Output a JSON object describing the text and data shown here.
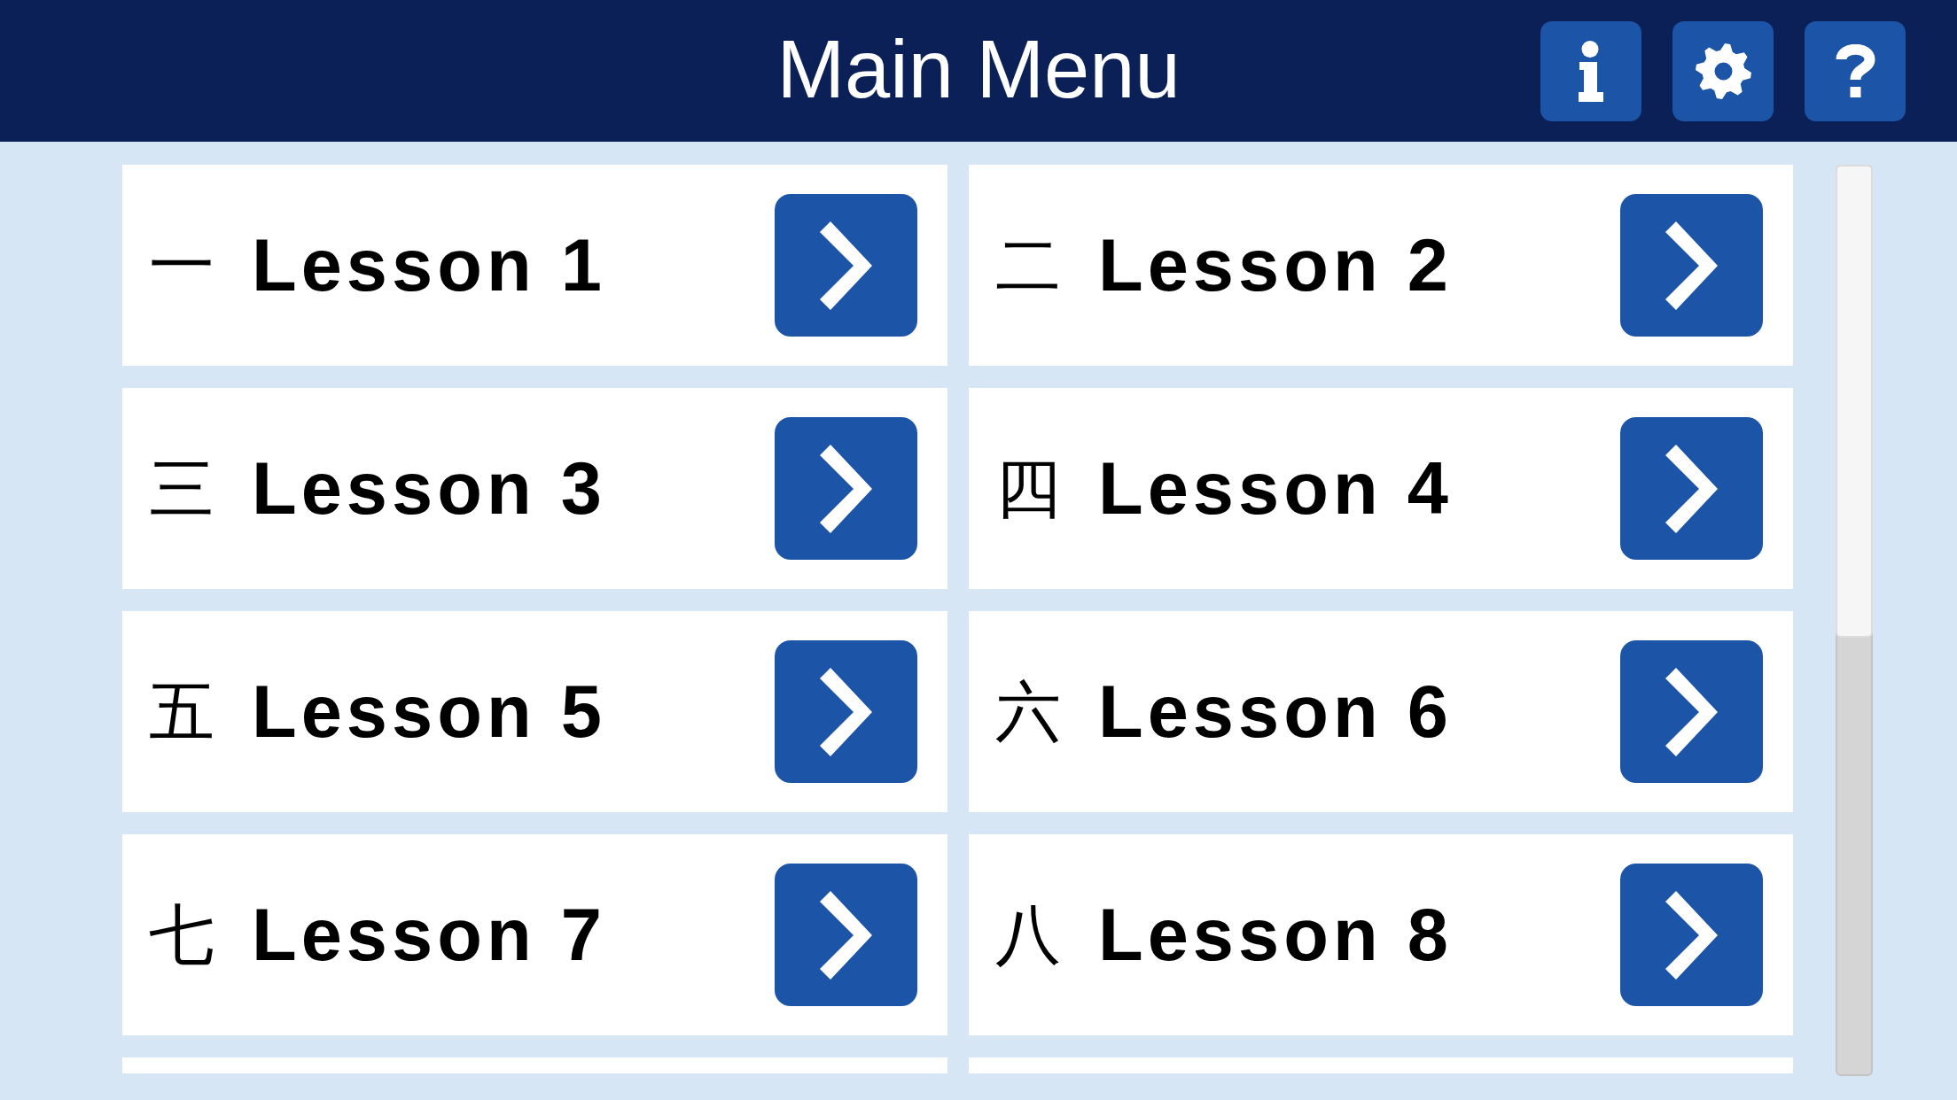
{
  "header": {
    "title": "Main Menu",
    "buttons": [
      {
        "kind": "info"
      },
      {
        "kind": "settings"
      },
      {
        "kind": "help"
      }
    ]
  },
  "lessons": [
    {
      "kind": "lesson",
      "numeral": "一",
      "label": "Lesson 1"
    },
    {
      "kind": "lesson",
      "numeral": "二",
      "label": "Lesson 2"
    },
    {
      "kind": "lesson",
      "numeral": "三",
      "label": "Lesson 3"
    },
    {
      "kind": "lesson",
      "numeral": "四",
      "label": "Lesson 4"
    },
    {
      "kind": "lesson",
      "numeral": "五",
      "label": "Lesson 5"
    },
    {
      "kind": "lesson",
      "numeral": "六",
      "label": "Lesson 6"
    },
    {
      "kind": "lesson",
      "numeral": "七",
      "label": "Lesson 7"
    },
    {
      "kind": "lesson",
      "numeral": "八",
      "label": "Lesson 8"
    },
    {
      "kind": "cut_off"
    },
    {
      "kind": "cut_off"
    }
  ]
}
